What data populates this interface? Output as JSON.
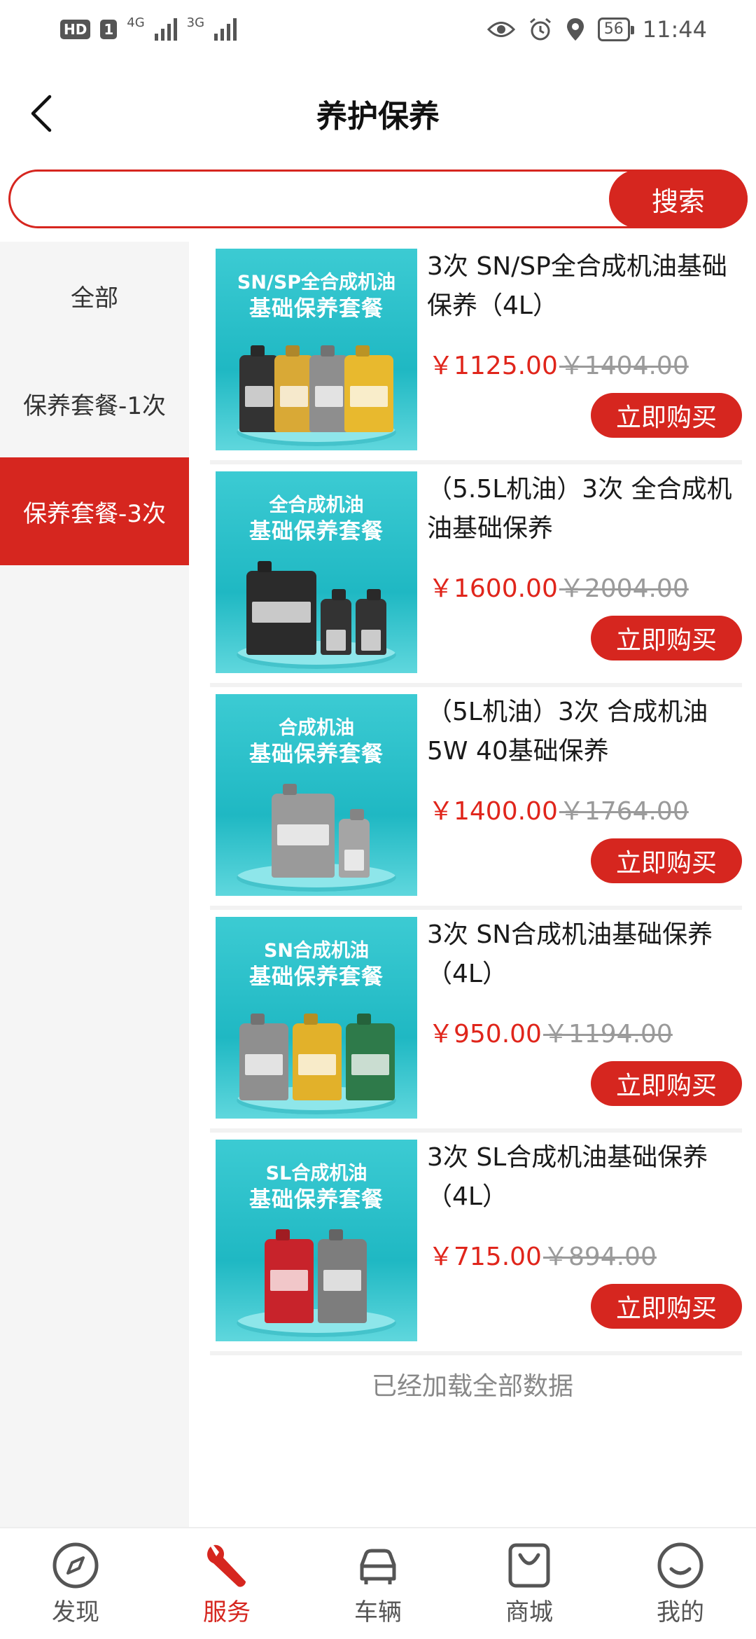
{
  "status_bar": {
    "hd": "HD",
    "sim": "1",
    "net1": "4G",
    "net2": "3G",
    "battery": "56",
    "time": "11:44"
  },
  "header": {
    "title": "养护保养"
  },
  "search": {
    "placeholder": "",
    "button_label": "搜索"
  },
  "sidebar": {
    "items": [
      {
        "label": "全部"
      },
      {
        "label": "保养套餐-1次"
      },
      {
        "label": "保养套餐-3次"
      }
    ],
    "active_index": 2
  },
  "products": [
    {
      "thumb_line1": "SN/SP全合成机油",
      "thumb_line2": "基础保养套餐",
      "title": "3次 SN/SP全合成机油基础保养（4L）",
      "price": "￥1125.00",
      "original_price": "￥1404.00",
      "buy_label": "立即购买"
    },
    {
      "thumb_line1": "全合成机油",
      "thumb_line2": "基础保养套餐",
      "title": "（5.5L机油）3次 全合成机油基础保养",
      "price": "￥1600.00",
      "original_price": "￥2004.00",
      "buy_label": "立即购买"
    },
    {
      "thumb_line1": "合成机油",
      "thumb_line2": "基础保养套餐",
      "title": "（5L机油）3次 合成机油5W 40基础保养",
      "price": "￥1400.00",
      "original_price": "￥1764.00",
      "buy_label": "立即购买"
    },
    {
      "thumb_line1": "SN合成机油",
      "thumb_line2": "基础保养套餐",
      "title": "3次 SN合成机油基础保养（4L）",
      "price": "￥950.00",
      "original_price": "￥1194.00",
      "buy_label": "立即购买"
    },
    {
      "thumb_line1": "SL合成机油",
      "thumb_line2": "基础保养套餐",
      "title": "3次 SL合成机油基础保养（4L）",
      "price": "￥715.00",
      "original_price": "￥894.00",
      "buy_label": "立即购买"
    }
  ],
  "list_footer": "已经加载全部数据",
  "tabbar": {
    "items": [
      {
        "label": "发现",
        "icon": "compass-icon"
      },
      {
        "label": "服务",
        "icon": "wrench-icon"
      },
      {
        "label": "车辆",
        "icon": "car-icon"
      },
      {
        "label": "商城",
        "icon": "shopping-bag-icon"
      },
      {
        "label": "我的",
        "icon": "smile-icon"
      }
    ],
    "active_index": 1
  },
  "colors": {
    "accent": "#d6261f",
    "price": "#e0251b",
    "thumb_bg": "#2cc2cc"
  }
}
